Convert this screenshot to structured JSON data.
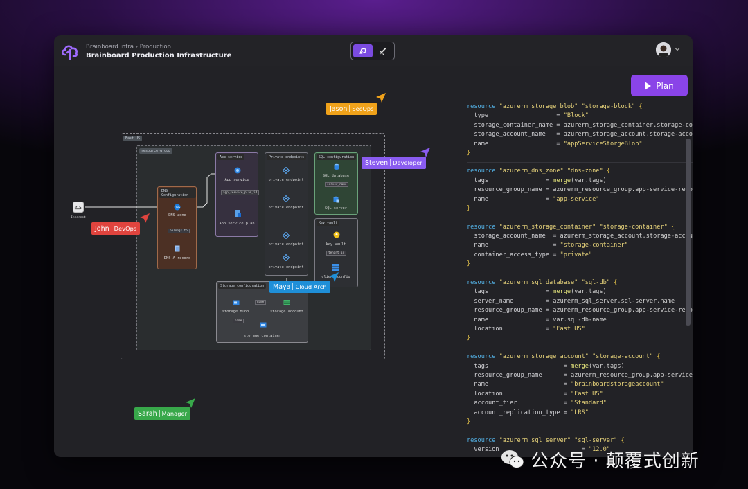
{
  "header": {
    "breadcrumb": "Brainboard infra › Production",
    "title": "Brainboard Production Infrastructure"
  },
  "plan_button": {
    "label": "Plan"
  },
  "diagram": {
    "region_label": "East US",
    "resource_group_label": "resource-group",
    "internet_label": "Internet",
    "groups": {
      "dns": "DNS Configuration",
      "app": "App service",
      "pe": "Private endpoints",
      "sql": "SQL configuration",
      "kv": "Key vault",
      "storage": "Storage configuration"
    },
    "nodes": {
      "dns_zone": "DNS zone",
      "dns_a": "DNS A record",
      "app_service": "App service",
      "app_plan": "App service plan",
      "pe1": "private endpoint",
      "pe2": "private endpoint",
      "pe3": "private endpoint",
      "pe4": "private endpoint",
      "sql_db": "SQL database",
      "sql_server": "SQL server",
      "key_vault": "key vault",
      "client_config": "client config",
      "storage_blob": "storage blob",
      "storage_account": "storage account",
      "storage_container": "storage container"
    },
    "edge_labels": {
      "belongs_to": "belongs to",
      "app_service_plan_id": "app_service_plan_id",
      "server_name": "server_name",
      "tenant_id": "tenant_id",
      "name1": "name",
      "name2": "name"
    }
  },
  "cursors": [
    {
      "id": "jason",
      "name": "Jason",
      "role": "SecOps",
      "color": "#f0a21a"
    },
    {
      "id": "steven",
      "name": "Steven",
      "role": "Developer",
      "color": "#8a5cf0"
    },
    {
      "id": "john",
      "name": "John",
      "role": "DevOps",
      "color": "#e0443e"
    },
    {
      "id": "maya",
      "name": "Maya",
      "role": "Cloud Arch",
      "color": "#1f8fd8"
    },
    {
      "id": "sarah",
      "name": "Sarah",
      "role": "Manager",
      "color": "#38a84a"
    }
  ],
  "code_blocks": [
    [
      [
        [
          "kw",
          "resource "
        ],
        [
          "s",
          "\"azurerm_storage_blob\" \"storage-block\" "
        ],
        [
          "br",
          "{"
        ]
      ],
      [
        [
          "k",
          "  type                   "
        ],
        [
          "op",
          "= "
        ],
        [
          "s",
          "\"Block\""
        ]
      ],
      [
        [
          "k",
          "  storage_container_name "
        ],
        [
          "op",
          "= "
        ],
        [
          "v",
          "azurerm_storage_container.storage-container.name"
        ]
      ],
      [
        [
          "k",
          "  storage_account_name   "
        ],
        [
          "op",
          "= "
        ],
        [
          "v",
          "azurerm_storage_account.storage-account.name"
        ]
      ],
      [
        [
          "k",
          "  name                   "
        ],
        [
          "op",
          "= "
        ],
        [
          "s",
          "\"appServiceStorgeBlob\""
        ]
      ],
      [
        [
          "br",
          "}"
        ]
      ]
    ],
    [
      [
        [
          "kw",
          "resource "
        ],
        [
          "s",
          "\"azurerm_dns_zone\" \"dns-zone\" "
        ],
        [
          "br",
          "{"
        ]
      ],
      [
        [
          "k",
          "  tags                "
        ],
        [
          "op",
          "= "
        ],
        [
          "f",
          "merge"
        ],
        [
          "v",
          "(var.tags)"
        ]
      ],
      [
        [
          "k",
          "  resource_group_name "
        ],
        [
          "op",
          "= "
        ],
        [
          "v",
          "azurerm_resource_group.app-service-resource-group.name"
        ]
      ],
      [
        [
          "k",
          "  name                "
        ],
        [
          "op",
          "= "
        ],
        [
          "s",
          "\"app-service\""
        ]
      ],
      [
        [
          "br",
          "}"
        ]
      ],
      [],
      [
        [
          "kw",
          "resource "
        ],
        [
          "s",
          "\"azurerm_storage_container\" \"storage-container\" "
        ],
        [
          "br",
          "{"
        ]
      ],
      [
        [
          "k",
          "  storage_account_name  "
        ],
        [
          "op",
          "= "
        ],
        [
          "v",
          "azurerm_storage_account.storage-account.name"
        ]
      ],
      [
        [
          "k",
          "  name                  "
        ],
        [
          "op",
          "= "
        ],
        [
          "s",
          "\"storage-container\""
        ]
      ],
      [
        [
          "k",
          "  container_access_type "
        ],
        [
          "op",
          "= "
        ],
        [
          "s",
          "\"private\""
        ]
      ],
      [
        [
          "br",
          "}"
        ]
      ],
      [],
      [
        [
          "kw",
          "resource "
        ],
        [
          "s",
          "\"azurerm_sql_database\" \"sql-db\" "
        ],
        [
          "br",
          "{"
        ]
      ],
      [
        [
          "k",
          "  tags                "
        ],
        [
          "op",
          "= "
        ],
        [
          "f",
          "merge"
        ],
        [
          "v",
          "(var.tags)"
        ]
      ],
      [
        [
          "k",
          "  server_name         "
        ],
        [
          "op",
          "= "
        ],
        [
          "v",
          "azurerm_sql_server.sql-server.name"
        ]
      ],
      [
        [
          "k",
          "  resource_group_name "
        ],
        [
          "op",
          "= "
        ],
        [
          "v",
          "azurerm_resource_group.app-service-resource-group.name"
        ]
      ],
      [
        [
          "k",
          "  name                "
        ],
        [
          "op",
          "= "
        ],
        [
          "v",
          "var.sql-db-name"
        ]
      ],
      [
        [
          "k",
          "  location            "
        ],
        [
          "op",
          "= "
        ],
        [
          "s",
          "\"East US\""
        ]
      ],
      [
        [
          "br",
          "}"
        ]
      ],
      [],
      [
        [
          "kw",
          "resource "
        ],
        [
          "s",
          "\"azurerm_storage_account\" \"storage-account\" "
        ],
        [
          "br",
          "{"
        ]
      ],
      [
        [
          "k",
          "  tags                     "
        ],
        [
          "op",
          "= "
        ],
        [
          "f",
          "merge"
        ],
        [
          "v",
          "(var.tags)"
        ]
      ],
      [
        [
          "k",
          "  resource_group_name      "
        ],
        [
          "op",
          "= "
        ],
        [
          "v",
          "azurerm_resource_group.app-service-resource-group.name"
        ]
      ],
      [
        [
          "k",
          "  name                     "
        ],
        [
          "op",
          "= "
        ],
        [
          "s",
          "\"brainboardstorageaccount\""
        ]
      ],
      [
        [
          "k",
          "  location                 "
        ],
        [
          "op",
          "= "
        ],
        [
          "s",
          "\"East US\""
        ]
      ],
      [
        [
          "k",
          "  account_tier             "
        ],
        [
          "op",
          "= "
        ],
        [
          "s",
          "\"Standard\""
        ]
      ],
      [
        [
          "k",
          "  account_replication_type "
        ],
        [
          "op",
          "= "
        ],
        [
          "s",
          "\"LRS\""
        ]
      ],
      [
        [
          "br",
          "}"
        ]
      ],
      [],
      [
        [
          "kw",
          "resource "
        ],
        [
          "s",
          "\"azurerm_sql_server\" \"sql-server\" "
        ],
        [
          "br",
          "{"
        ]
      ],
      [
        [
          "k",
          "  version"
        ],
        [
          "op",
          "                       = "
        ],
        [
          "s",
          "\"12.0\""
        ]
      ]
    ]
  ],
  "watermark": {
    "text": "公众号 · 颠覆式创新"
  },
  "icons": {
    "logo": "brainboard-cloud-logo-icon",
    "design": "pen-design-icon",
    "deploy": "rocket-icon",
    "avatar": "user-avatar",
    "chevron": "chevron-down-icon"
  }
}
